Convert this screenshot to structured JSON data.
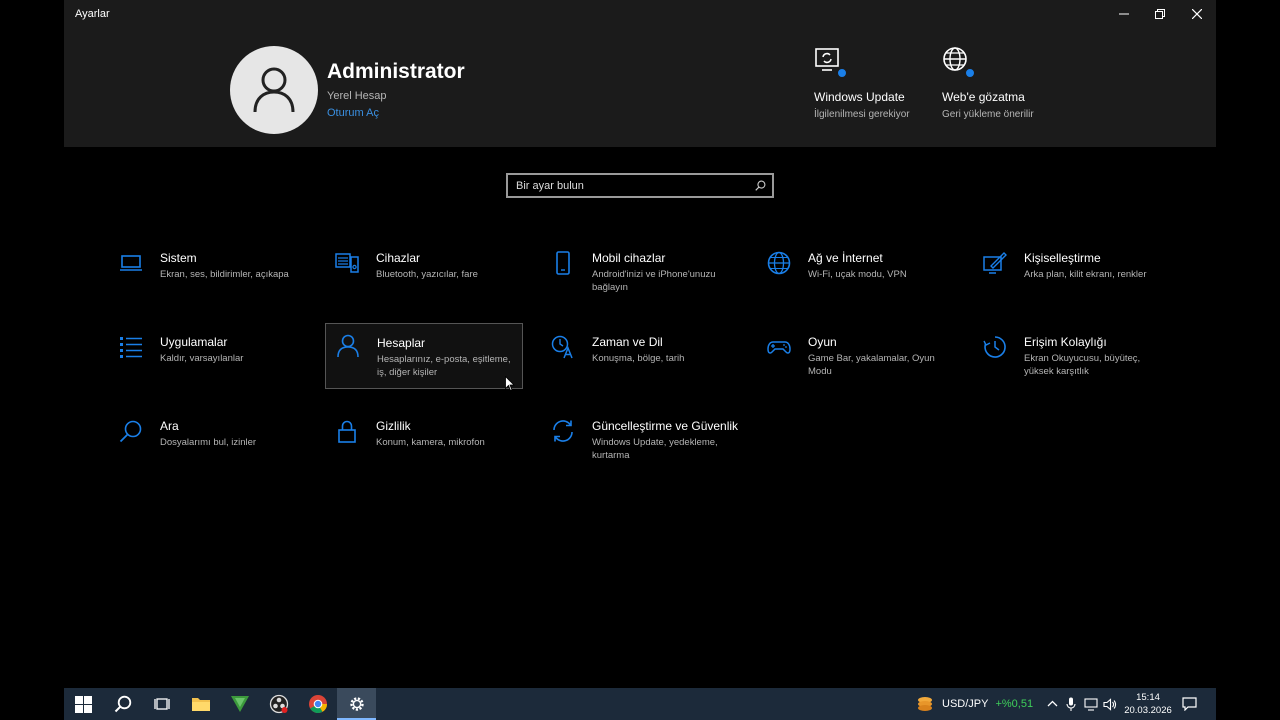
{
  "window": {
    "title": "Ayarlar"
  },
  "account": {
    "name": "Administrator",
    "type": "Yerel Hesap",
    "signin_link": "Oturum Aç"
  },
  "promos": [
    {
      "icon": "windows-update-icon",
      "title": "Windows Update",
      "subtitle": "İlgilenilmesi gerekiyor"
    },
    {
      "icon": "globe-icon",
      "title": "Web'e gözatma",
      "subtitle": "Geri yükleme önerilir"
    }
  ],
  "search": {
    "placeholder": "Bir ayar bulun"
  },
  "categories": [
    {
      "icon": "laptop-icon",
      "title": "Sistem",
      "desc": "Ekran, ses, bildirimler, açıkapa"
    },
    {
      "icon": "devices-icon",
      "title": "Cihazlar",
      "desc": "Bluetooth, yazıcılar, fare"
    },
    {
      "icon": "phone-icon",
      "title": "Mobil cihazlar",
      "desc": "Android'inizi ve iPhone'unuzu bağlayın"
    },
    {
      "icon": "globe-icon",
      "title": "Ağ ve İnternet",
      "desc": "Wi-Fi, uçak modu, VPN"
    },
    {
      "icon": "personalization-icon",
      "title": "Kişiselleştirme",
      "desc": "Arka plan, kilit ekranı, renkler"
    },
    {
      "icon": "apps-list-icon",
      "title": "Uygulamalar",
      "desc": "Kaldır, varsayılanlar"
    },
    {
      "icon": "person-icon",
      "title": "Hesaplar",
      "desc": "Hesaplarınız, e-posta, eşitleme, iş, diğer kişiler"
    },
    {
      "icon": "time-language-icon",
      "title": "Zaman ve Dil",
      "desc": "Konuşma, bölge, tarih"
    },
    {
      "icon": "gamepad-icon",
      "title": "Oyun",
      "desc": "Game Bar, yakalamalar, Oyun Modu"
    },
    {
      "icon": "accessibility-icon",
      "title": "Erişim Kolaylığı",
      "desc": "Ekran Okuyucusu, büyüteç, yüksek karşıtlık"
    },
    {
      "icon": "search-icon",
      "title": "Ara",
      "desc": "Dosyalarımı bul, izinler"
    },
    {
      "icon": "lock-icon",
      "title": "Gizlilik",
      "desc": "Konum, kamera, mikrofon"
    },
    {
      "icon": "sync-icon",
      "title": "Güncelleştirme ve Güvenlik",
      "desc": "Windows Update, yedekleme, kurtarma"
    }
  ],
  "taskbar": {
    "apps": [
      "start-icon",
      "search-icon",
      "task-view-icon",
      "file-explorer-icon",
      "vim-icon",
      "obs-icon",
      "chrome-icon",
      "settings-gear-icon"
    ],
    "ticker": {
      "symbol": "USD/JPY",
      "change": "+%0,51",
      "change_color": "#3ecf5a"
    },
    "time": "15:14",
    "date": "20.03.2026"
  },
  "accent_color": "#1a7fe8"
}
